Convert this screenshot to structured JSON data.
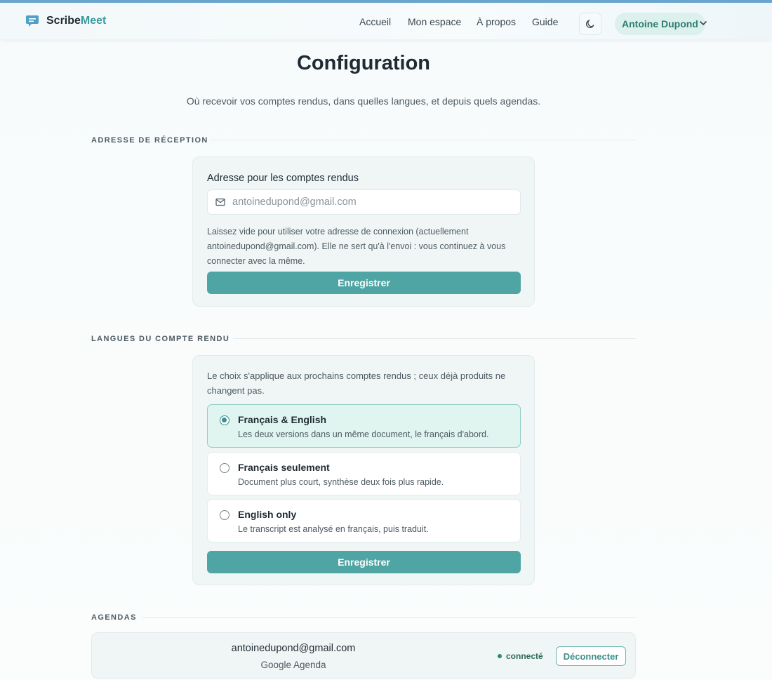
{
  "app": {
    "brand_part1": "Scribe",
    "brand_part2": "Meet",
    "accent_color": "#4fa5a4"
  },
  "nav": {
    "items": [
      "Accueil",
      "Mon espace",
      "À propos",
      "Guide"
    ],
    "theme_toggle_icon": "moon-icon",
    "user_name": "Antoine Dupond",
    "user_menu_icon": "chevron-down-icon"
  },
  "page": {
    "title": "Configuration",
    "subtitle": "Où recevoir vos comptes rendus, dans quelles langues, et depuis quels agendas."
  },
  "reception": {
    "section_title": "ADRESSE DE RÉCEPTION",
    "field_label": "Adresse pour les comptes rendus",
    "field_icon": "mail-icon",
    "field_value": "",
    "field_placeholder": "antoinedupond@gmail.com",
    "help_text": "Laissez vide pour utiliser votre adresse de connexion (actuellement antoinedupond@gmail.com). Elle ne sert qu'à l'envoi : vous continuez à vous connecter avec la même.",
    "save_label": "Enregistrer"
  },
  "languages": {
    "section_title": "LANGUES DU COMPTE RENDU",
    "intro": "Le choix s'applique aux prochains comptes rendus ; ceux déjà produits ne changent pas.",
    "options": [
      {
        "title": "Français & English",
        "description": "Les deux versions dans un même document, le français d'abord.",
        "selected": true
      },
      {
        "title": "Français seulement",
        "description": "Document plus court, synthèse deux fois plus rapide.",
        "selected": false
      },
      {
        "title": "English only",
        "description": "Le transcript est analysé en français, puis traduit.",
        "selected": false
      }
    ],
    "save_label": "Enregistrer"
  },
  "agendas": {
    "section_title": "AGENDAS",
    "items": [
      {
        "email": "antoinedupond@gmail.com",
        "provider": "Google Agenda",
        "status": "connecté",
        "action_label": "Déconnecter"
      }
    ]
  }
}
